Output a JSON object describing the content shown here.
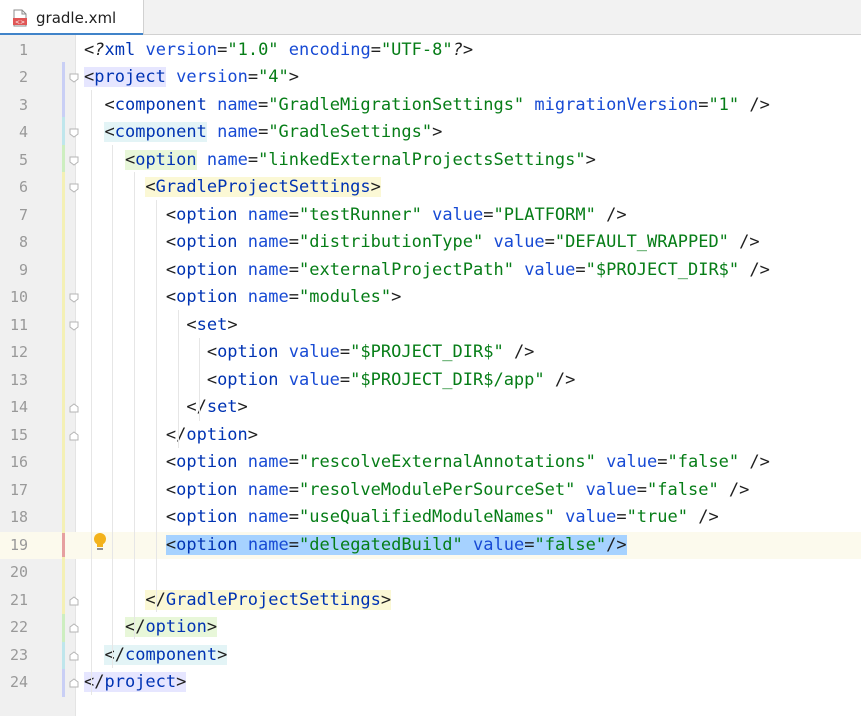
{
  "tab": {
    "filename": "gradle.xml",
    "icon": "xml-file-icon"
  },
  "lines": [
    {
      "num": "1",
      "parts": [
        [
          "t-pi",
          "<?"
        ],
        [
          "t-tag",
          "xml"
        ],
        [
          "t-punct",
          " "
        ],
        [
          "t-attr",
          "version"
        ],
        [
          "t-eq",
          "="
        ],
        [
          "t-val",
          "\"1.0\""
        ],
        [
          "t-punct",
          " "
        ],
        [
          "t-attr",
          "encoding"
        ],
        [
          "t-eq",
          "="
        ],
        [
          "t-val",
          "\"UTF-8\""
        ],
        [
          "t-pi",
          "?>"
        ]
      ]
    },
    {
      "num": "2",
      "parts": [
        [
          "t-punct hl-project",
          "<"
        ],
        [
          "t-tag hl-project",
          "project"
        ],
        [
          "t-punct",
          " "
        ],
        [
          "t-attr",
          "version"
        ],
        [
          "t-eq",
          "="
        ],
        [
          "t-val",
          "\"4\""
        ],
        [
          "t-punct",
          ">"
        ]
      ]
    },
    {
      "num": "3",
      "parts": [
        [
          "t-punct",
          "  <"
        ],
        [
          "t-tag",
          "component"
        ],
        [
          "t-punct",
          " "
        ],
        [
          "t-attr",
          "name"
        ],
        [
          "t-eq",
          "="
        ],
        [
          "t-val",
          "\"GradleMigrationSettings\""
        ],
        [
          "t-punct",
          " "
        ],
        [
          "t-attr",
          "migrationVersion"
        ],
        [
          "t-eq",
          "="
        ],
        [
          "t-val",
          "\"1\""
        ],
        [
          "t-punct",
          " />"
        ]
      ]
    },
    {
      "num": "4",
      "parts": [
        [
          "t-punct",
          "  "
        ],
        [
          "t-punct hl-component",
          "<"
        ],
        [
          "t-tag hl-component",
          "component"
        ],
        [
          "t-punct",
          " "
        ],
        [
          "t-attr",
          "name"
        ],
        [
          "t-eq",
          "="
        ],
        [
          "t-val",
          "\"GradleSettings\""
        ],
        [
          "t-punct",
          ">"
        ]
      ]
    },
    {
      "num": "5",
      "parts": [
        [
          "t-punct",
          "    "
        ],
        [
          "t-punct hl-option",
          "<"
        ],
        [
          "t-tag hl-option",
          "option"
        ],
        [
          "t-punct",
          " "
        ],
        [
          "t-attr",
          "name"
        ],
        [
          "t-eq",
          "="
        ],
        [
          "t-val",
          "\"linkedExternalProjectsSettings\""
        ],
        [
          "t-punct",
          ">"
        ]
      ]
    },
    {
      "num": "6",
      "parts": [
        [
          "t-punct",
          "      "
        ],
        [
          "t-punct hl-gps",
          "<"
        ],
        [
          "t-tag hl-gps",
          "GradleProjectSettings"
        ],
        [
          "t-punct hl-gps",
          ">"
        ]
      ]
    },
    {
      "num": "7",
      "parts": [
        [
          "t-punct",
          "        <"
        ],
        [
          "t-tag",
          "option"
        ],
        [
          "t-punct",
          " "
        ],
        [
          "t-attr",
          "name"
        ],
        [
          "t-eq",
          "="
        ],
        [
          "t-val",
          "\"testRunner\""
        ],
        [
          "t-punct",
          " "
        ],
        [
          "t-attr",
          "value"
        ],
        [
          "t-eq",
          "="
        ],
        [
          "t-val",
          "\"PLATFORM\""
        ],
        [
          "t-punct",
          " />"
        ]
      ]
    },
    {
      "num": "8",
      "parts": [
        [
          "t-punct",
          "        <"
        ],
        [
          "t-tag",
          "option"
        ],
        [
          "t-punct",
          " "
        ],
        [
          "t-attr",
          "name"
        ],
        [
          "t-eq",
          "="
        ],
        [
          "t-val",
          "\"distributionType\""
        ],
        [
          "t-punct",
          " "
        ],
        [
          "t-attr",
          "value"
        ],
        [
          "t-eq",
          "="
        ],
        [
          "t-val",
          "\"DEFAULT_WRAPPED\""
        ],
        [
          "t-punct",
          " />"
        ]
      ]
    },
    {
      "num": "9",
      "parts": [
        [
          "t-punct",
          "        <"
        ],
        [
          "t-tag",
          "option"
        ],
        [
          "t-punct",
          " "
        ],
        [
          "t-attr",
          "name"
        ],
        [
          "t-eq",
          "="
        ],
        [
          "t-val",
          "\"externalProjectPath\""
        ],
        [
          "t-punct",
          " "
        ],
        [
          "t-attr",
          "value"
        ],
        [
          "t-eq",
          "="
        ],
        [
          "t-val",
          "\"$PROJECT_DIR$\""
        ],
        [
          "t-punct",
          " />"
        ]
      ]
    },
    {
      "num": "10",
      "parts": [
        [
          "t-punct",
          "        <"
        ],
        [
          "t-tag",
          "option"
        ],
        [
          "t-punct",
          " "
        ],
        [
          "t-attr",
          "name"
        ],
        [
          "t-eq",
          "="
        ],
        [
          "t-val",
          "\"modules\""
        ],
        [
          "t-punct",
          ">"
        ]
      ]
    },
    {
      "num": "11",
      "parts": [
        [
          "t-punct",
          "          <"
        ],
        [
          "t-tag",
          "set"
        ],
        [
          "t-punct",
          ">"
        ]
      ]
    },
    {
      "num": "12",
      "parts": [
        [
          "t-punct",
          "            <"
        ],
        [
          "t-tag",
          "option"
        ],
        [
          "t-punct",
          " "
        ],
        [
          "t-attr",
          "value"
        ],
        [
          "t-eq",
          "="
        ],
        [
          "t-val",
          "\"$PROJECT_DIR$\""
        ],
        [
          "t-punct",
          " />"
        ]
      ]
    },
    {
      "num": "13",
      "parts": [
        [
          "t-punct",
          "            <"
        ],
        [
          "t-tag",
          "option"
        ],
        [
          "t-punct",
          " "
        ],
        [
          "t-attr",
          "value"
        ],
        [
          "t-eq",
          "="
        ],
        [
          "t-val",
          "\"$PROJECT_DIR$/app\""
        ],
        [
          "t-punct",
          " />"
        ]
      ]
    },
    {
      "num": "14",
      "parts": [
        [
          "t-punct",
          "          </"
        ],
        [
          "t-tag",
          "set"
        ],
        [
          "t-punct",
          ">"
        ]
      ]
    },
    {
      "num": "15",
      "parts": [
        [
          "t-punct",
          "        </"
        ],
        [
          "t-tag",
          "option"
        ],
        [
          "t-punct",
          ">"
        ]
      ]
    },
    {
      "num": "16",
      "parts": [
        [
          "t-punct",
          "        <"
        ],
        [
          "t-tag",
          "option"
        ],
        [
          "t-punct",
          " "
        ],
        [
          "t-attr",
          "name"
        ],
        [
          "t-eq",
          "="
        ],
        [
          "t-val",
          "\"rescolveExternalAnnotations\""
        ],
        [
          "t-punct",
          " "
        ],
        [
          "t-attr",
          "value"
        ],
        [
          "t-eq",
          "="
        ],
        [
          "t-val",
          "\"false\""
        ],
        [
          "t-punct",
          " />"
        ]
      ]
    },
    {
      "num": "17",
      "parts": [
        [
          "t-punct",
          "        <"
        ],
        [
          "t-tag",
          "option"
        ],
        [
          "t-punct",
          " "
        ],
        [
          "t-attr",
          "name"
        ],
        [
          "t-eq",
          "="
        ],
        [
          "t-val",
          "\"resolveModulePerSourceSet\""
        ],
        [
          "t-punct",
          " "
        ],
        [
          "t-attr",
          "value"
        ],
        [
          "t-eq",
          "="
        ],
        [
          "t-val",
          "\"false\""
        ],
        [
          "t-punct",
          " />"
        ]
      ]
    },
    {
      "num": "18",
      "parts": [
        [
          "t-punct",
          "        <"
        ],
        [
          "t-tag",
          "option"
        ],
        [
          "t-punct",
          " "
        ],
        [
          "t-attr",
          "name"
        ],
        [
          "t-eq",
          "="
        ],
        [
          "t-val",
          "\"useQualifiedModuleNames\""
        ],
        [
          "t-punct",
          " "
        ],
        [
          "t-attr",
          "value"
        ],
        [
          "t-eq",
          "="
        ],
        [
          "t-val",
          "\"true\""
        ],
        [
          "t-punct",
          " />"
        ]
      ]
    },
    {
      "num": "19",
      "current": true,
      "parts": [
        [
          "t-punct",
          "        "
        ],
        [
          "t-punct sel",
          "<"
        ],
        [
          "t-tag sel",
          "option"
        ],
        [
          "t-punct sel",
          " "
        ],
        [
          "t-attr sel",
          "name"
        ],
        [
          "t-eq sel",
          "="
        ],
        [
          "t-val sel",
          "\"delegatedBuild\""
        ],
        [
          "t-punct sel",
          " "
        ],
        [
          "t-attr sel",
          "value"
        ],
        [
          "t-eq sel",
          "="
        ],
        [
          "t-val sel",
          "\"false\""
        ],
        [
          "t-punct sel",
          "/>"
        ]
      ]
    },
    {
      "num": "20",
      "parts": []
    },
    {
      "num": "21",
      "parts": [
        [
          "t-punct",
          "      "
        ],
        [
          "t-punct hl-gps",
          "</"
        ],
        [
          "t-tag hl-gps",
          "GradleProjectSettings"
        ],
        [
          "t-punct hl-gps",
          ">"
        ]
      ]
    },
    {
      "num": "22",
      "parts": [
        [
          "t-punct",
          "    "
        ],
        [
          "t-punct hl-option",
          "</"
        ],
        [
          "t-tag hl-option",
          "option"
        ],
        [
          "t-punct hl-option",
          ">"
        ]
      ]
    },
    {
      "num": "23",
      "parts": [
        [
          "t-punct",
          "  "
        ],
        [
          "t-punct hl-component",
          "</"
        ],
        [
          "t-tag hl-component",
          "component"
        ],
        [
          "t-punct hl-component",
          ">"
        ]
      ]
    },
    {
      "num": "24",
      "parts": [
        [
          "t-punct hl-project",
          "</"
        ],
        [
          "t-tag hl-project",
          "project"
        ],
        [
          "t-punct hl-project",
          ">"
        ]
      ]
    }
  ],
  "gutter_icons": {
    "intention": "lightbulb-icon",
    "fold": "fold-marker-icon"
  },
  "colors": {
    "tag": "#0033b3",
    "attr": "#174ad4",
    "value": "#067d17",
    "selection": "#a6d2ff",
    "gutter": "#f0f0f0",
    "tab_underline": "#4083c9"
  }
}
